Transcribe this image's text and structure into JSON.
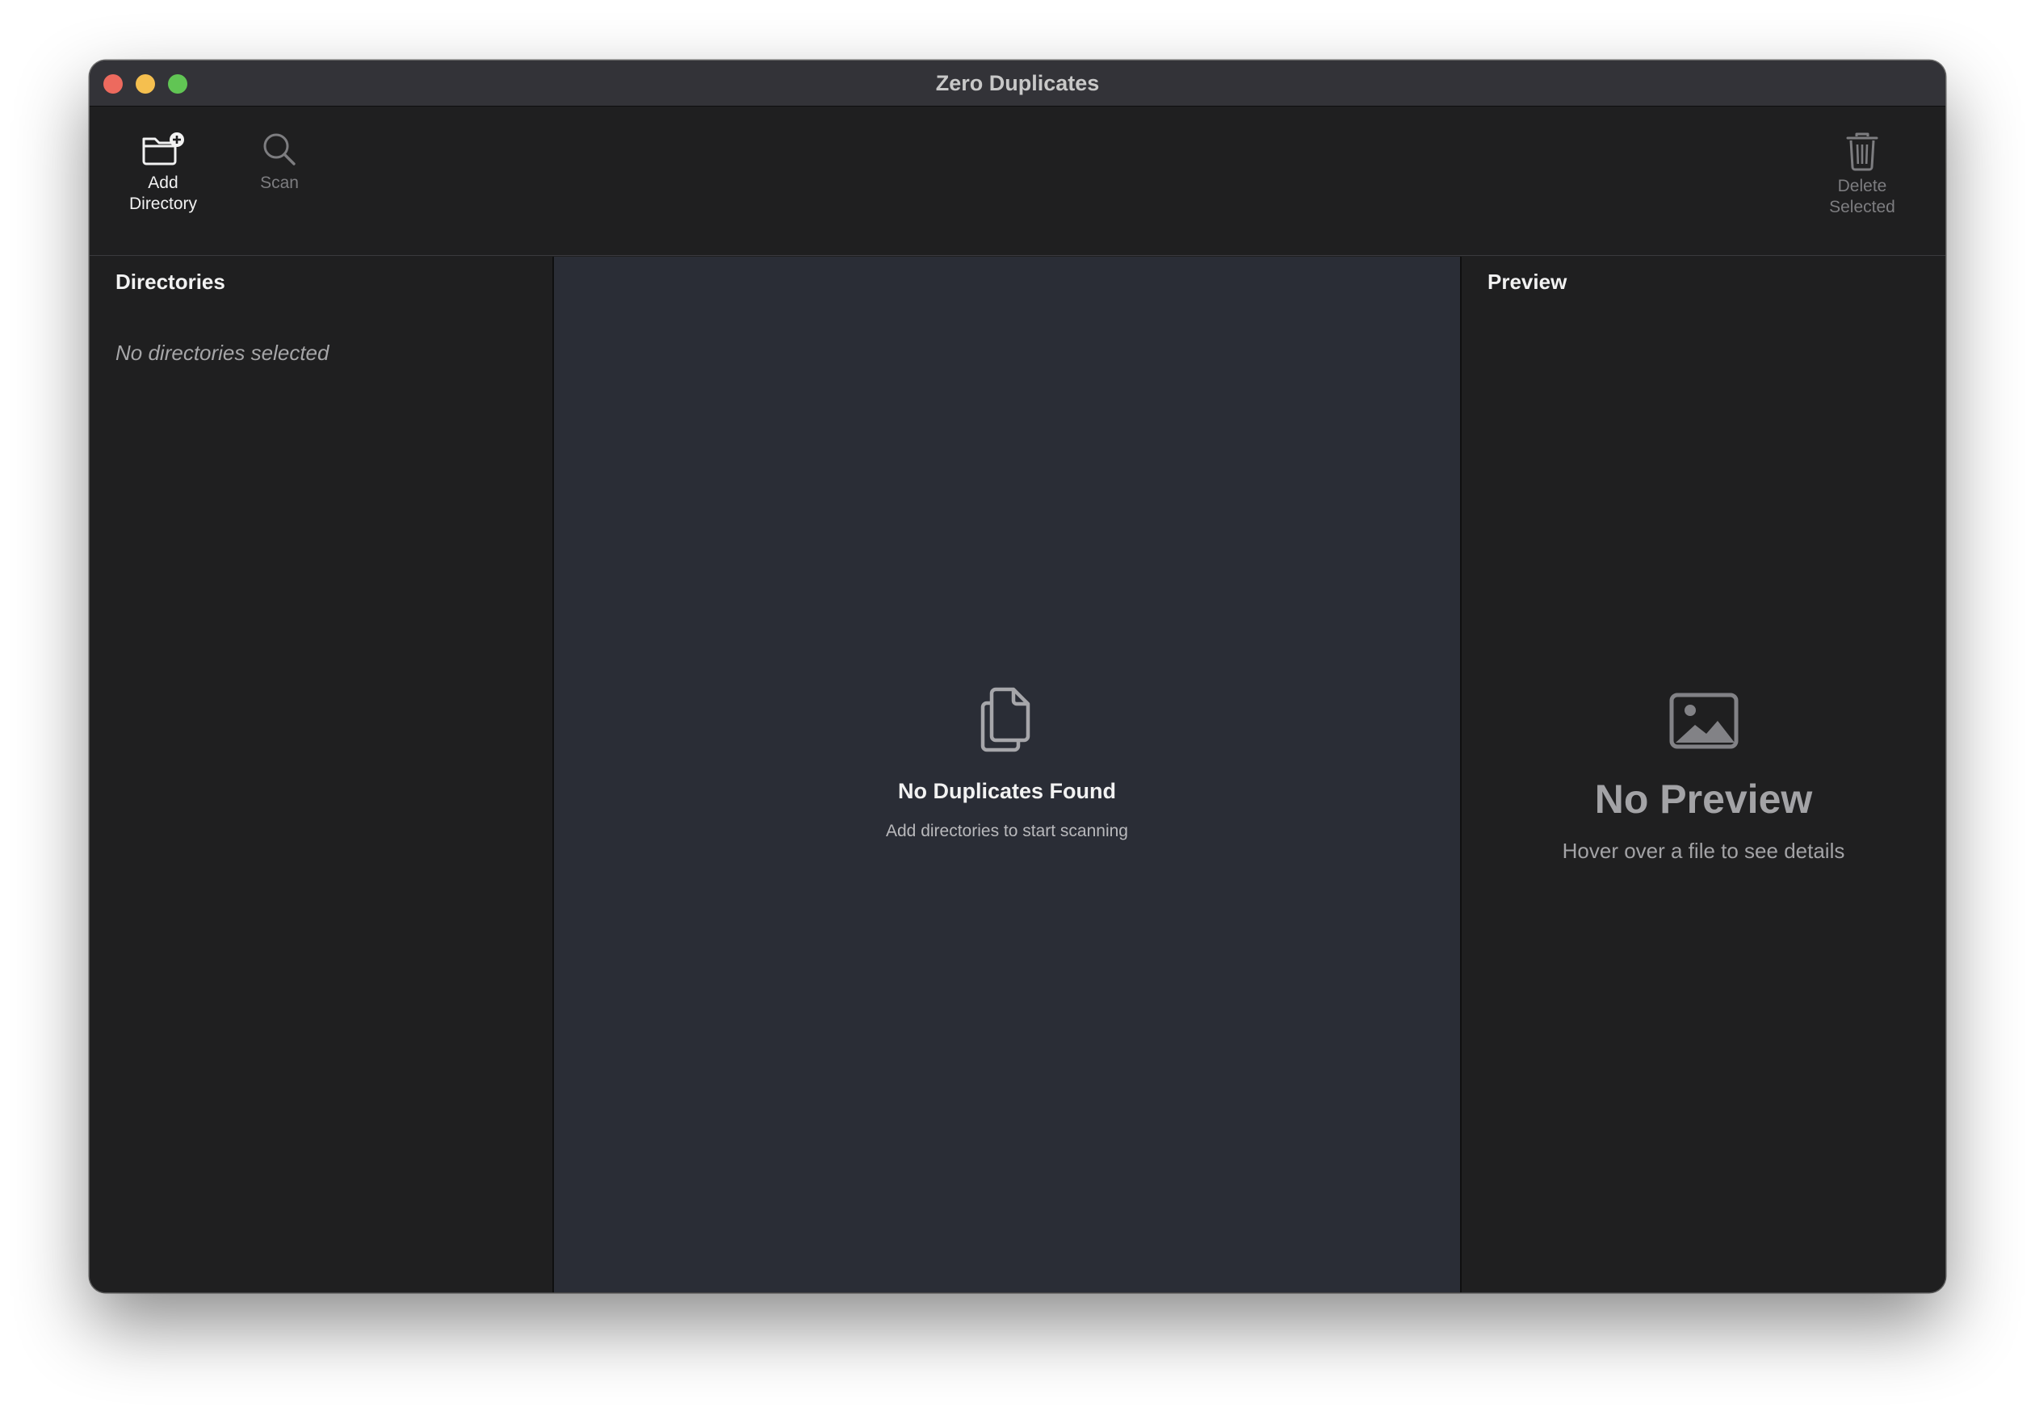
{
  "window": {
    "title": "Zero Duplicates"
  },
  "toolbar": {
    "add_directory": {
      "label": "Add\nDirectory",
      "icon": "folder-plus-icon"
    },
    "scan": {
      "label": "Scan",
      "icon": "search-icon"
    },
    "delete_selected": {
      "label": "Delete\nSelected",
      "icon": "trash-icon"
    }
  },
  "directories": {
    "heading": "Directories",
    "empty_text": "No directories selected"
  },
  "results": {
    "icon": "documents-icon",
    "empty_title": "No Duplicates Found",
    "empty_subtitle": "Add directories to start scanning"
  },
  "preview": {
    "heading": "Preview",
    "icon": "photo-icon",
    "empty_title": "No Preview",
    "empty_subtitle": "Hover over a file to see details"
  },
  "colors": {
    "close": "#ed6a5e",
    "minimize": "#f5bf4f",
    "maximize": "#61c554",
    "window_bg": "#1f1f20",
    "results_bg": "#2a2d36"
  }
}
